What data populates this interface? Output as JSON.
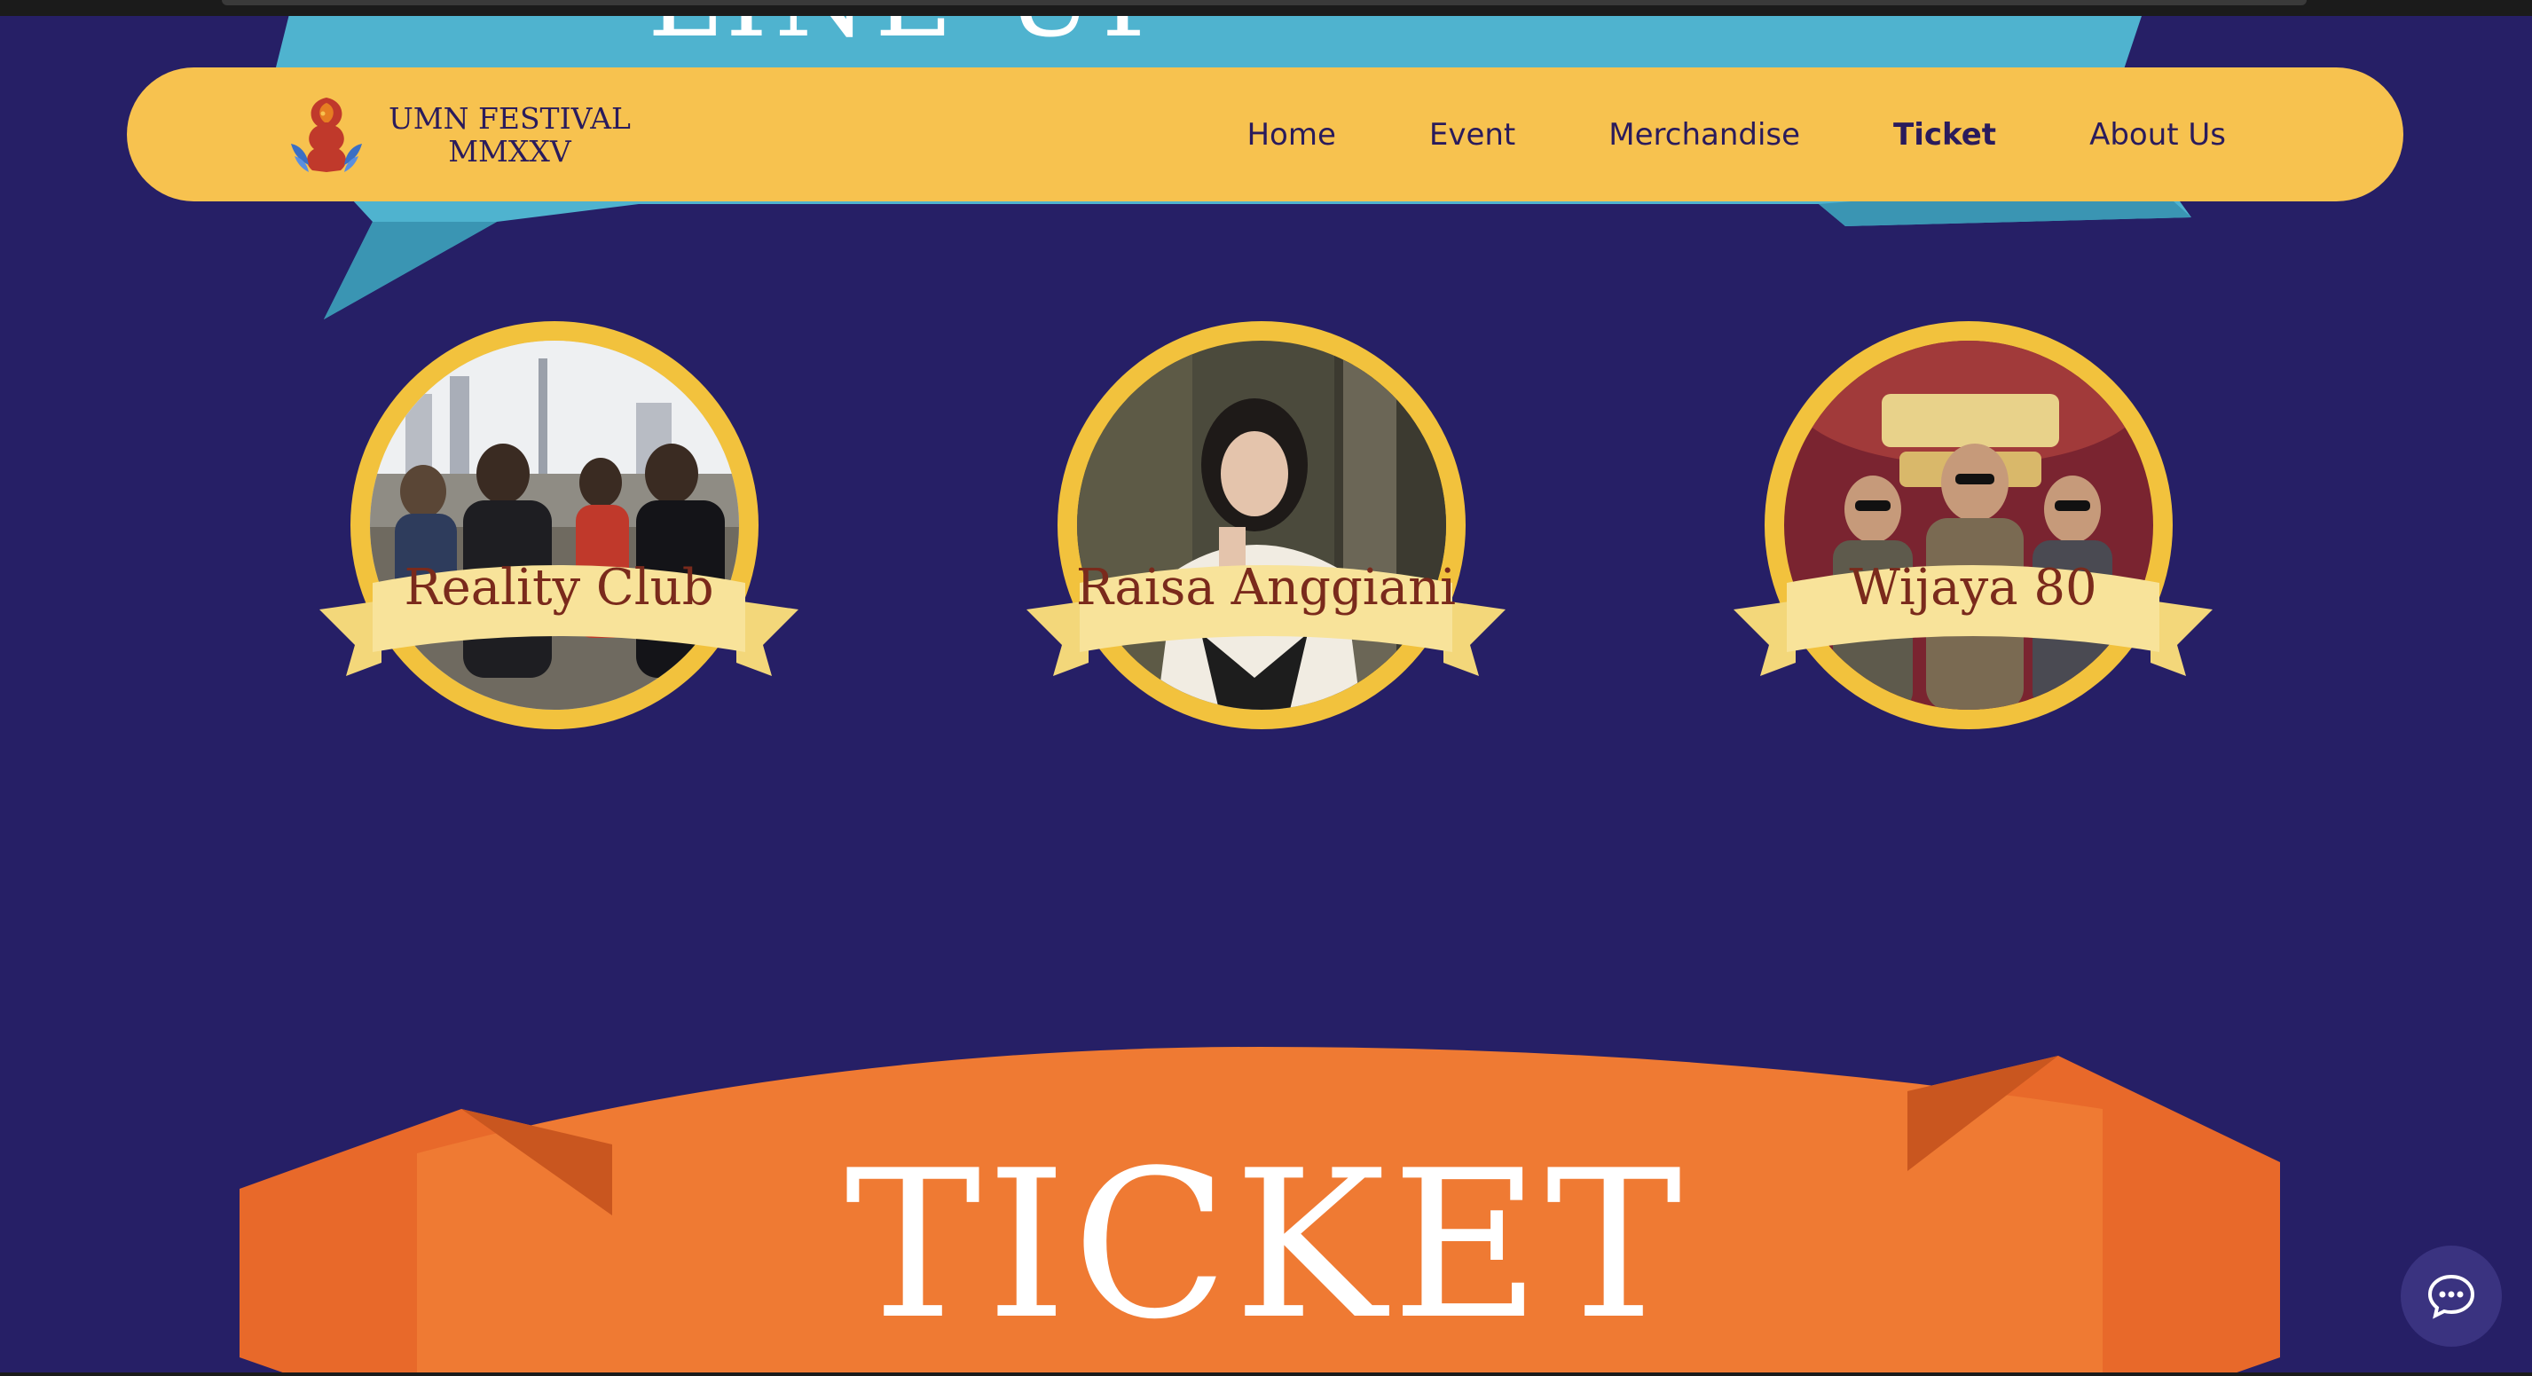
{
  "header": {
    "logo_line1": "UMN FESTIVAL",
    "logo_line2": "MMXXV",
    "nav": [
      {
        "label": "Home",
        "active": false
      },
      {
        "label": "Event",
        "active": false
      },
      {
        "label": "Merchandise",
        "active": false
      },
      {
        "label": "Ticket",
        "active": true
      },
      {
        "label": "About Us",
        "active": false
      }
    ]
  },
  "lineup": {
    "heading_partial": "LINE-UP",
    "artists": [
      {
        "name": "Reality Club"
      },
      {
        "name": "Raisa Anggiani"
      },
      {
        "name": "Wijaya 80"
      }
    ]
  },
  "ticket": {
    "title": "TICKET"
  },
  "chat": {
    "icon": "chat-bubble-icon"
  },
  "colors": {
    "background": "#261f66",
    "nav_bg": "#f7c24f",
    "nav_text": "#2a1b5c",
    "ribbon": "#f8e39a",
    "artist_name": "#7a2a1c",
    "ticket_banner": "#ef7a33",
    "teal_banner": "#4fb3cf"
  }
}
